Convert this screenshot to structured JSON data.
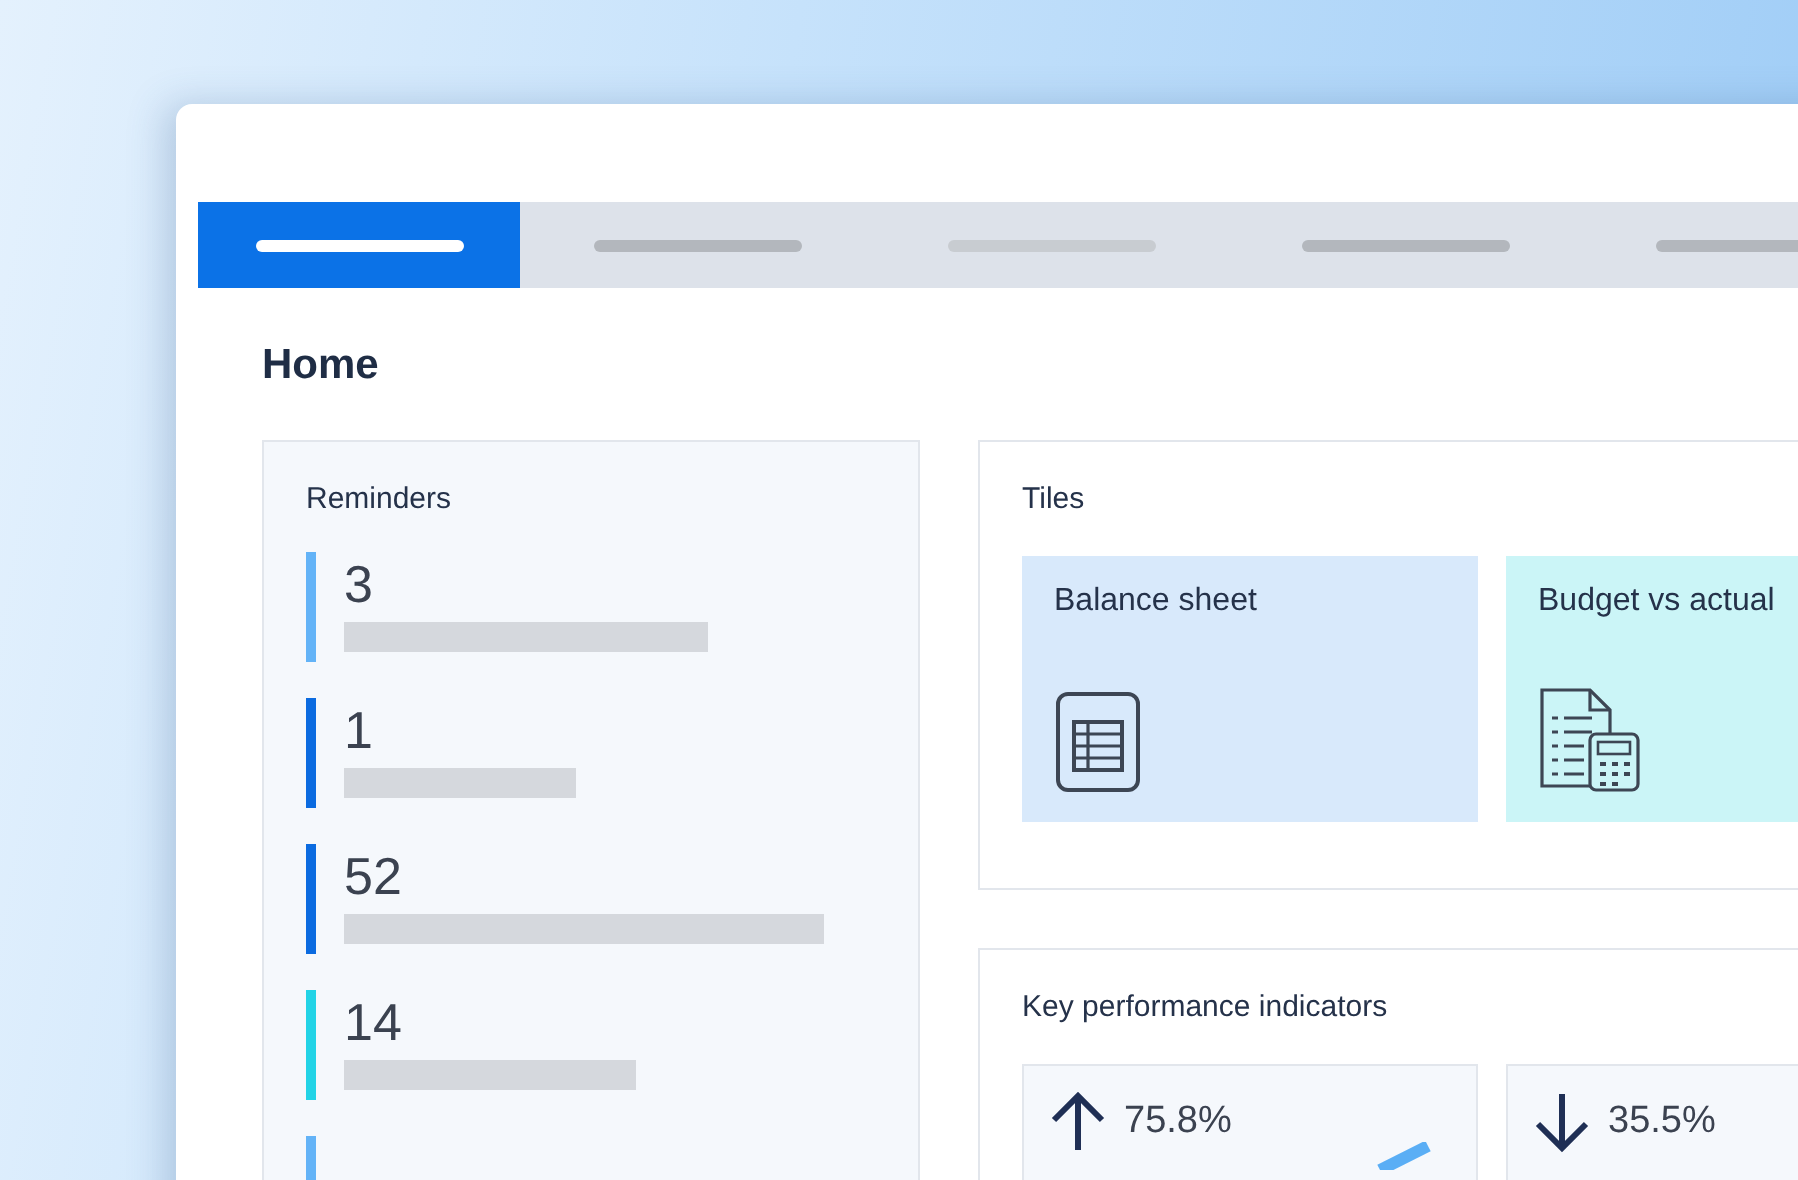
{
  "tabs": [
    {
      "selected": true
    },
    {
      "selected": false
    },
    {
      "selected": false
    },
    {
      "selected": false
    },
    {
      "selected": false
    }
  ],
  "page_title": "Home",
  "reminders": {
    "title": "Reminders",
    "items": [
      {
        "count": "3",
        "color": "#63b3f7"
      },
      {
        "count": "1",
        "color": "#0b6be0"
      },
      {
        "count": "52",
        "color": "#0b6be0"
      },
      {
        "count": "14",
        "color": "#22d3e6"
      },
      {
        "color": "#63b3f7"
      }
    ]
  },
  "tiles": {
    "title": "Tiles",
    "items": [
      {
        "label": "Balance sheet",
        "color": "#d8e9fb",
        "kind": "table"
      },
      {
        "label": "Budget vs actual",
        "color": "#cbf5f7",
        "kind": "calculator"
      }
    ]
  },
  "kpis": {
    "title": "Key performance indicators",
    "items": [
      {
        "value": "75.8%",
        "kind": "up"
      },
      {
        "value": "35.5%",
        "kind": "down"
      }
    ]
  }
}
